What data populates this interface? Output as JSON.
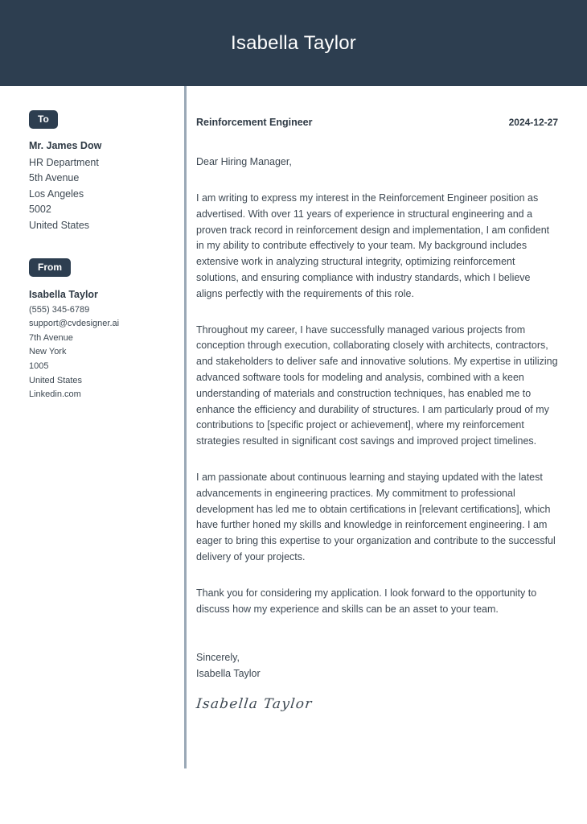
{
  "header": {
    "name": "Isabella Taylor"
  },
  "sidebar": {
    "to": {
      "badge_label": "To",
      "name": "Mr. James Dow",
      "lines": [
        "HR Department",
        "5th Avenue",
        "Los Angeles",
        "5002",
        "United States"
      ]
    },
    "from": {
      "badge_label": "From",
      "name": "Isabella Taylor",
      "lines": [
        "(555) 345-6789",
        "support@cvdesigner.ai",
        "7th Avenue",
        "New York",
        "1005",
        "United States",
        "Linkedin.com"
      ]
    }
  },
  "letter": {
    "job_title": "Reinforcement Engineer",
    "date": "2024-12-27",
    "salutation": "Dear Hiring Manager,",
    "paragraphs": [
      "I am writing to express my interest in the Reinforcement Engineer position as advertised. With over 11 years of experience in structural engineering and a proven track record in reinforcement design and implementation, I am confident in my ability to contribute effectively to your team. My background includes extensive work in analyzing structural integrity, optimizing reinforcement solutions, and ensuring compliance with industry standards, which I believe aligns perfectly with the requirements of this role.",
      "Throughout my career, I have successfully managed various projects from conception through execution, collaborating closely with architects, contractors, and stakeholders to deliver safe and innovative solutions. My expertise in utilizing advanced software tools for modeling and analysis, combined with a keen understanding of materials and construction techniques, has enabled me to enhance the efficiency and durability of structures. I am particularly proud of my contributions to [specific project or achievement], where my reinforcement strategies resulted in significant cost savings and improved project timelines.",
      "I am passionate about continuous learning and staying updated with the latest advancements in engineering practices. My commitment to professional development has led me to obtain certifications in [relevant certifications], which have further honed my skills and knowledge in reinforcement engineering. I am eager to bring this expertise to your organization and contribute to the successful delivery of your projects.",
      "Thank you for considering my application. I look forward to the opportunity to discuss how my experience and skills can be an asset to your team."
    ],
    "closing_word": "Sincerely,",
    "closing_name": "Isabella Taylor",
    "signature": "Isabella Taylor"
  },
  "colors": {
    "header_background": "#2d3e50",
    "badge_background": "#2d3e50",
    "divider": "#9aa8b6",
    "text": "#3d4852"
  }
}
